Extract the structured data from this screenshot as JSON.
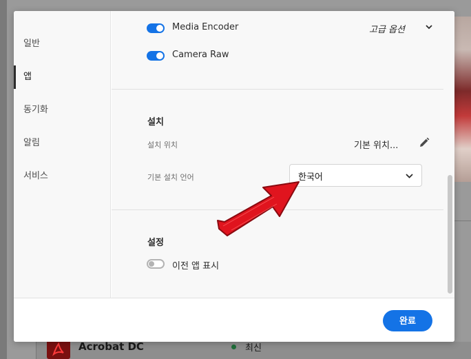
{
  "sidebar": {
    "items": [
      {
        "label": "일반",
        "active": false
      },
      {
        "label": "앱",
        "active": true
      },
      {
        "label": "동기화",
        "active": false
      },
      {
        "label": "알림",
        "active": false
      },
      {
        "label": "서비스",
        "active": false
      }
    ]
  },
  "apps_section": {
    "toggles": [
      {
        "label": "Media Encoder",
        "on": true
      },
      {
        "label": "Camera Raw",
        "on": true
      }
    ],
    "advanced_options_label": "고급 옵션"
  },
  "install_section": {
    "title": "설치",
    "location_label": "설치 위치",
    "location_value": "기본 위치...",
    "language_label": "기본 설치 언어",
    "language_value": "한국어"
  },
  "settings_section": {
    "title": "설정",
    "show_previous_apps_label": "이전 앱 표시",
    "show_previous_apps_on": false
  },
  "footer": {
    "done_label": "완료"
  },
  "background": {
    "app_name": "Acrobat DC",
    "app_status": "최신"
  },
  "colors": {
    "accent": "#1473e6",
    "annotation_arrow": "#e0141e"
  }
}
